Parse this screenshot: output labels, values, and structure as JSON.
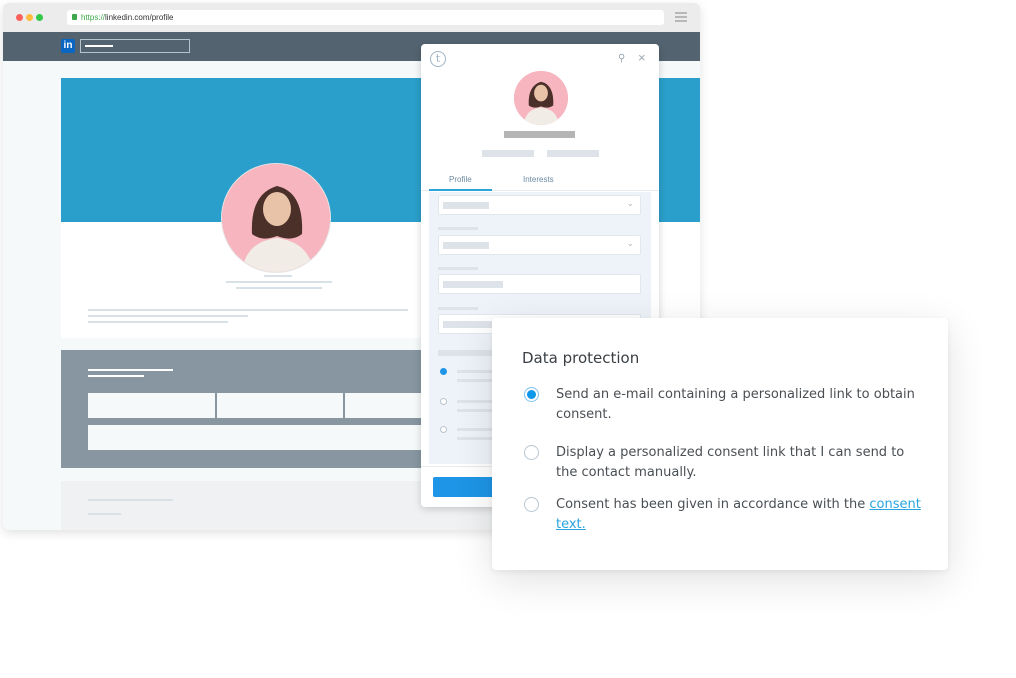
{
  "browser": {
    "url_scheme": "https://",
    "url_rest": "linkedin.com/profile",
    "linkedin_logo": "in"
  },
  "plugin": {
    "logo": "t",
    "tabs": [
      {
        "label": "Profile",
        "active": true
      },
      {
        "label": "Interests",
        "active": false
      }
    ],
    "radio_selected_index": 0
  },
  "dialog": {
    "title": "Data protection",
    "options": [
      {
        "text": "Send an e-mail containing a personalized link to obtain consent.",
        "selected": true
      },
      {
        "text": "Display a personalized consent link that I can send to the contact manually.",
        "selected": false
      },
      {
        "text_before_link": "Consent has been given in accordance with the ",
        "link_text": "consent text.",
        "selected": false
      }
    ]
  },
  "colors": {
    "accent": "#0d97ea",
    "cover": "#2a9fcb",
    "navbar": "#536470",
    "link": "#2aa3df"
  }
}
